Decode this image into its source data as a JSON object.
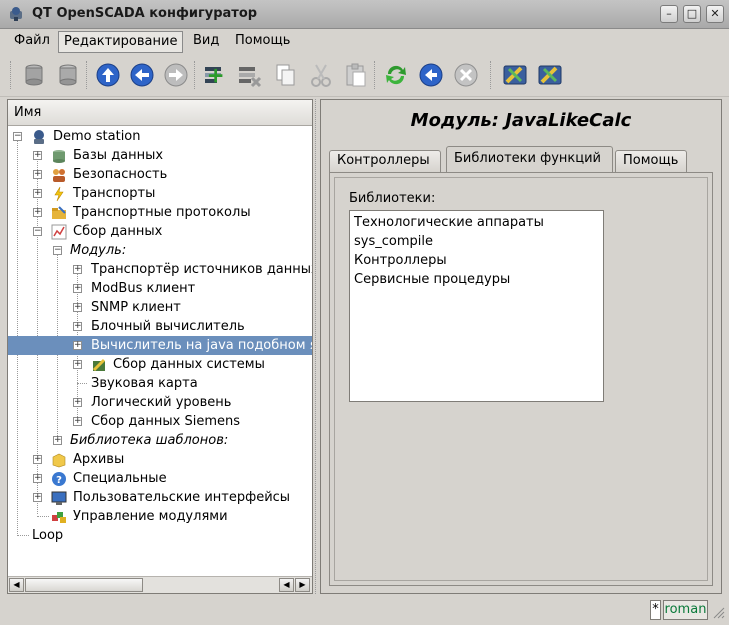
{
  "window": {
    "title": "QT OpenSCADA конфигуратор"
  },
  "menu": [
    {
      "label": "Файл"
    },
    {
      "label": "Редактирование"
    },
    {
      "label": "Вид"
    },
    {
      "label": "Помощь"
    }
  ],
  "toolbar": {
    "buttons": [
      "db-load-icon",
      "db-save-icon",
      "up-icon",
      "back-icon",
      "forward-icon",
      "add-item-icon",
      "delete-item-icon",
      "copy-icon",
      "cut-icon",
      "paste-icon",
      "refresh-icon",
      "start-icon",
      "stop-icon",
      "config-tool-icon",
      "config-tool2-icon"
    ]
  },
  "tree": {
    "header": "Имя",
    "items": [
      {
        "label": "Demo station"
      },
      {
        "label": "Базы данных"
      },
      {
        "label": "Безопасность"
      },
      {
        "label": "Транспорты"
      },
      {
        "label": "Транспортные протоколы"
      },
      {
        "label": "Сбор данных"
      },
      {
        "label": "Модуль:"
      },
      {
        "label": "Транспортёр источников данных"
      },
      {
        "label": "ModBus клиент"
      },
      {
        "label": "SNMP клиент"
      },
      {
        "label": "Блочный вычислитель"
      },
      {
        "label": "Вычислитель на java подобном языке"
      },
      {
        "label": "Сбор данных системы"
      },
      {
        "label": "Звуковая карта"
      },
      {
        "label": "Логический уровень"
      },
      {
        "label": "Сбор данных Siemens"
      },
      {
        "label": "Библиотека шаблонов:"
      },
      {
        "label": "Архивы"
      },
      {
        "label": "Специальные"
      },
      {
        "label": "Пользовательские интерфейсы"
      },
      {
        "label": "Управление модулями"
      },
      {
        "label": "Loop"
      }
    ]
  },
  "main": {
    "title": "Модуль: JavaLikeCalc",
    "tabs": [
      {
        "label": "Контроллеры"
      },
      {
        "label": "Библиотеки функций"
      },
      {
        "label": "Помощь"
      }
    ],
    "active_tab": "Библиотеки функций",
    "libraries_label": "Библиотеки:",
    "libraries": [
      "Технологические аппараты",
      "sys_compile",
      "Контроллеры",
      "Сервисные процедуры"
    ]
  },
  "status": {
    "modified": "*",
    "user": "roman"
  }
}
